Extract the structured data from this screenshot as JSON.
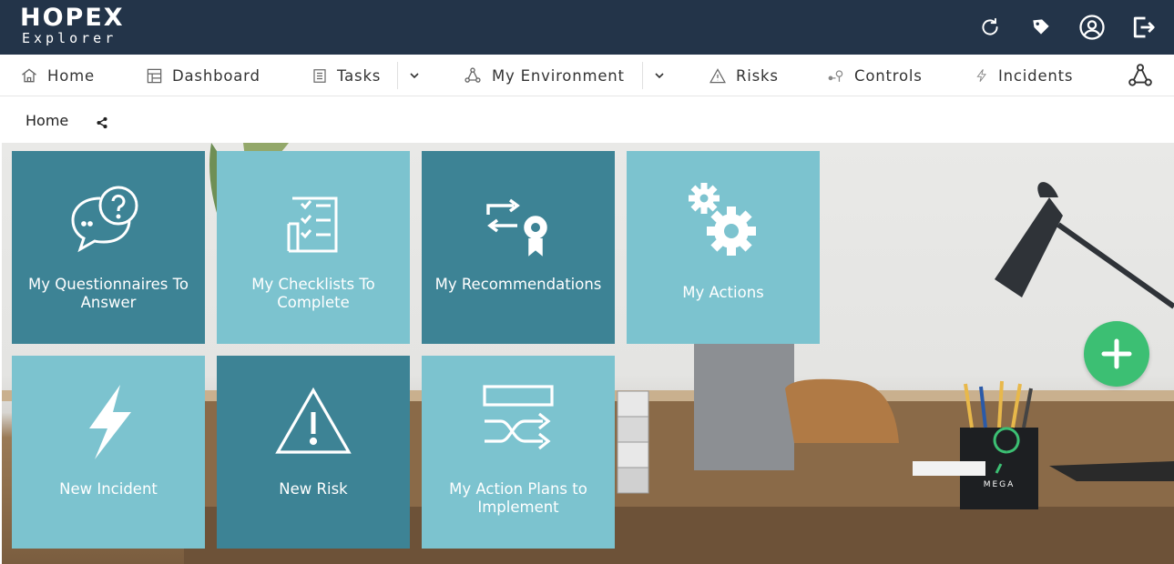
{
  "app": {
    "logo_title": "HOPEX",
    "logo_subtitle": "Explorer"
  },
  "topbar": {
    "icons": [
      "refresh-icon",
      "tag-icon",
      "user-icon",
      "logout-icon"
    ]
  },
  "nav": {
    "home": "Home",
    "dashboard": "Dashboard",
    "tasks": "Tasks",
    "my_environment": "My Environment",
    "risks": "Risks",
    "controls": "Controls",
    "incidents": "Incidents"
  },
  "breadcrumb": {
    "label": "Home"
  },
  "tiles": [
    {
      "label": "My Questionnaires To Answer",
      "icon": "questionnaire-icon",
      "color": "#3d8395"
    },
    {
      "label": "My Checklists To Complete",
      "icon": "checklist-icon",
      "color": "#7cc3cf"
    },
    {
      "label": "My Recommendations",
      "icon": "recommendation-icon",
      "color": "#3d8395"
    },
    {
      "label": "My Actions",
      "icon": "gears-icon",
      "color": "#7cc3cf"
    },
    {
      "label": "New Incident",
      "icon": "lightning-icon",
      "color": "#7cc3cf"
    },
    {
      "label": "New Risk",
      "icon": "warning-icon",
      "color": "#3d8395"
    },
    {
      "label": "My Action Plans to Implement",
      "icon": "action-plan-icon",
      "color": "#7cc3cf"
    }
  ],
  "fab": {
    "icon": "plus-icon",
    "color": "#3cbf73"
  },
  "background": {
    "pencil_holder_text": "MEGA"
  },
  "colors": {
    "topbar": "#233449",
    "tile_dark": "#3d8395",
    "tile_light": "#7cc3cf"
  }
}
